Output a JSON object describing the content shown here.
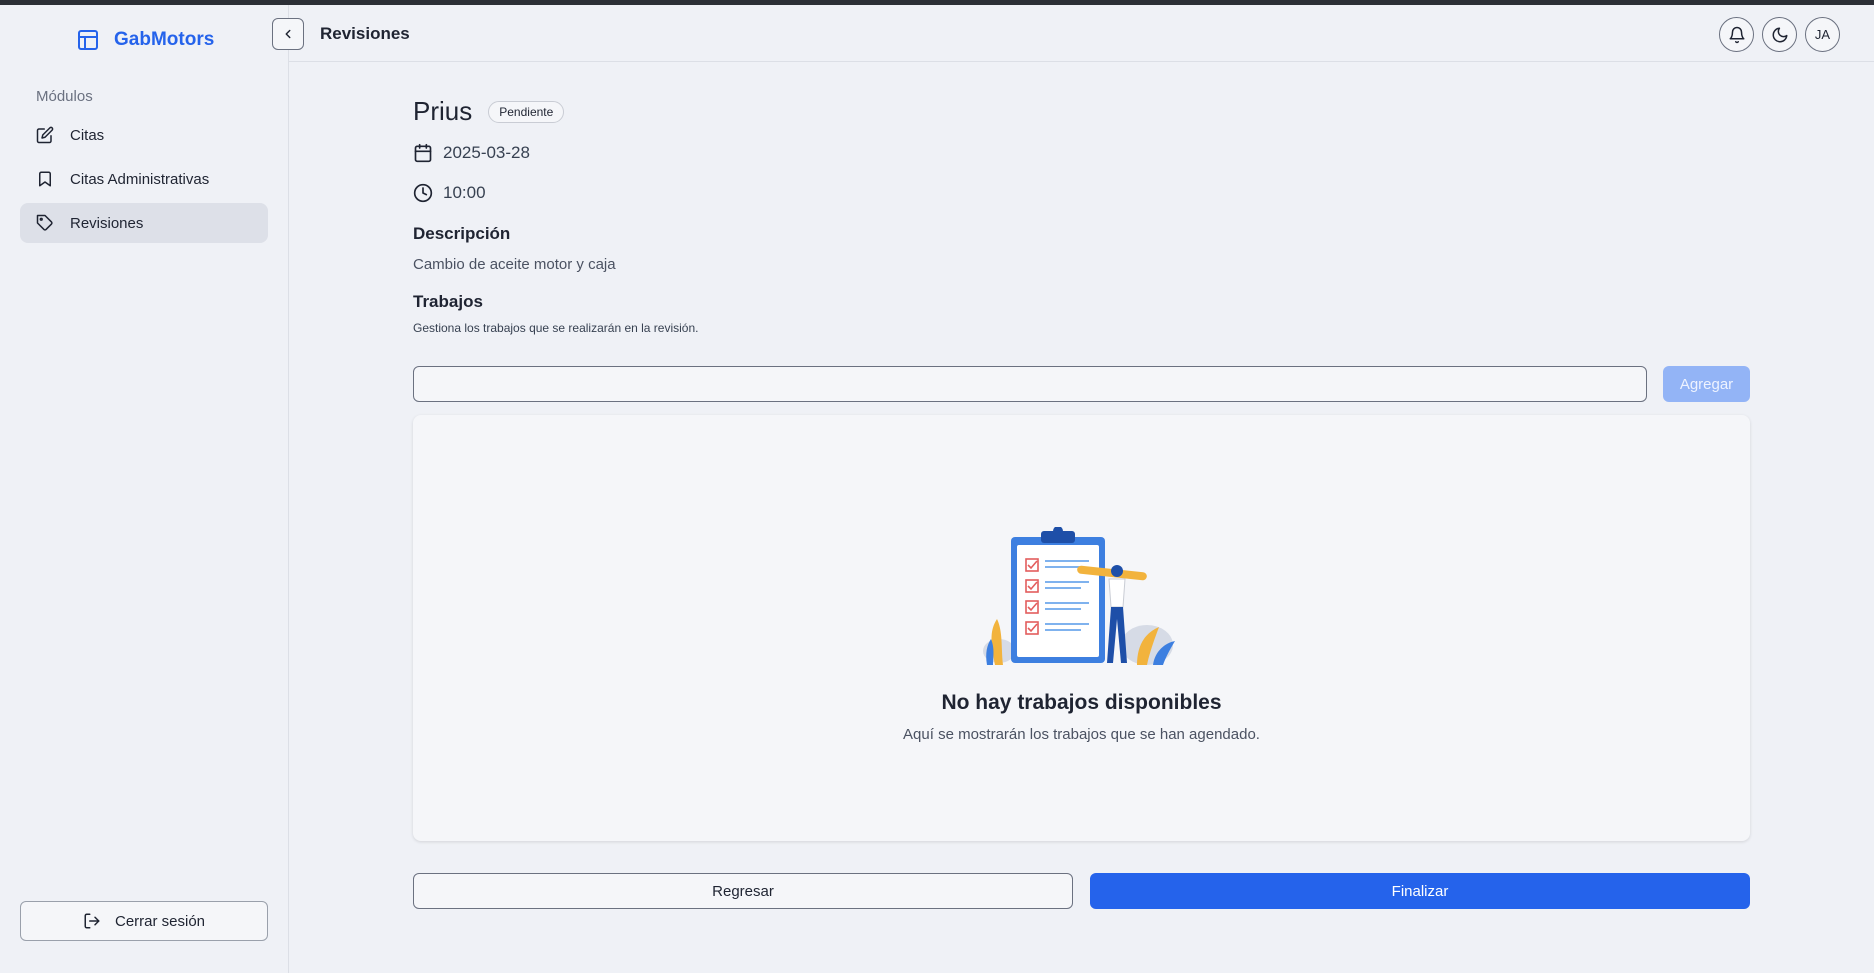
{
  "brand": {
    "name": "GabMotors",
    "icon": "layout-icon",
    "color": "#2563eb"
  },
  "sidebar": {
    "section_label": "Módulos",
    "items": [
      {
        "label": "Citas",
        "icon": "edit-icon",
        "active": false
      },
      {
        "label": "Citas Administrativas",
        "icon": "bookmark-icon",
        "active": false
      },
      {
        "label": "Revisiones",
        "icon": "tag-icon",
        "active": true
      }
    ],
    "logout_label": "Cerrar sesión"
  },
  "header": {
    "title": "Revisiones",
    "avatar_initials": "JA",
    "icons": [
      "bell-icon",
      "theme-toggle-icon"
    ]
  },
  "revision": {
    "vehicle": "Prius",
    "status": "Pendiente",
    "date": "2025-03-28",
    "time": "10:00",
    "description_heading": "Descripción",
    "description": "Cambio de aceite motor y caja",
    "jobs_heading": "Trabajos",
    "jobs_subtitle": "Gestiona los trabajos que se realizarán en la revisión.",
    "job_input_value": "",
    "add_label": "Agregar"
  },
  "empty_state": {
    "title": "No hay trabajos disponibles",
    "subtitle": "Aquí se mostrarán los trabajos que se han agendado."
  },
  "actions": {
    "back_label": "Regresar",
    "finish_label": "Finalizar"
  },
  "colors": {
    "primary": "#2563eb",
    "primary_disabled": "#93b4f6",
    "background": "#eff1f6"
  }
}
